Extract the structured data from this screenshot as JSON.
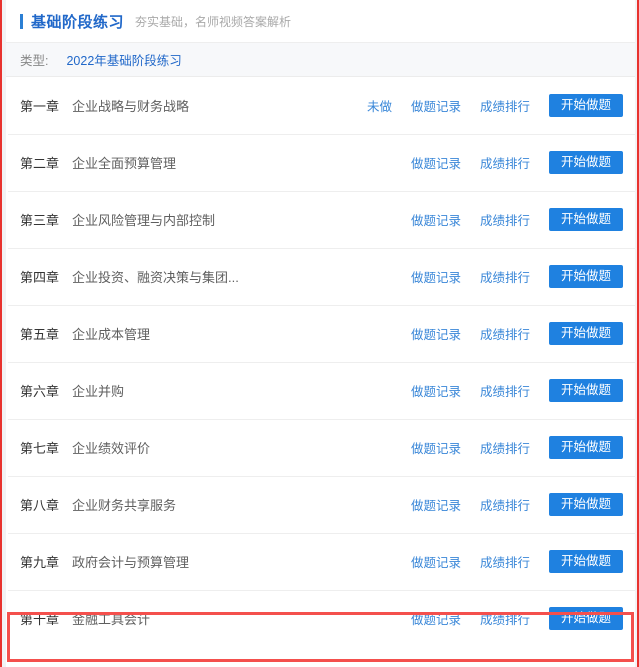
{
  "header": {
    "title": "基础阶段练习",
    "subtitle": "夯实基础，名师视频答案解析",
    "accent_color": "#2168c9"
  },
  "type_bar": {
    "label": "类型:",
    "selected_value": "2022年基础阶段练习"
  },
  "actions": {
    "record_label": "做题记录",
    "ranking_label": "成绩排行",
    "start_label": "开始做题",
    "button_color": "#1f81e0",
    "link_color": "#3a87d8"
  },
  "highlight": {
    "color": "#f4504d",
    "target_row_index": 9
  },
  "chapters": [
    {
      "number": "第一章",
      "title": "企业战略与财务战略",
      "status": "未做",
      "record_label": "做题记录",
      "ranking_label": "成绩排行",
      "start_label": "开始做题"
    },
    {
      "number": "第二章",
      "title": "企业全面预算管理",
      "status": "",
      "record_label": "做题记录",
      "ranking_label": "成绩排行",
      "start_label": "开始做题"
    },
    {
      "number": "第三章",
      "title": "企业风险管理与内部控制",
      "status": "",
      "record_label": "做题记录",
      "ranking_label": "成绩排行",
      "start_label": "开始做题"
    },
    {
      "number": "第四章",
      "title": "企业投资、融资决策与集团...",
      "status": "",
      "record_label": "做题记录",
      "ranking_label": "成绩排行",
      "start_label": "开始做题"
    },
    {
      "number": "第五章",
      "title": "企业成本管理",
      "status": "",
      "record_label": "做题记录",
      "ranking_label": "成绩排行",
      "start_label": "开始做题"
    },
    {
      "number": "第六章",
      "title": "企业并购",
      "status": "",
      "record_label": "做题记录",
      "ranking_label": "成绩排行",
      "start_label": "开始做题"
    },
    {
      "number": "第七章",
      "title": "企业绩效评价",
      "status": "",
      "record_label": "做题记录",
      "ranking_label": "成绩排行",
      "start_label": "开始做题"
    },
    {
      "number": "第八章",
      "title": "企业财务共享服务",
      "status": "",
      "record_label": "做题记录",
      "ranking_label": "成绩排行",
      "start_label": "开始做题"
    },
    {
      "number": "第九章",
      "title": "政府会计与预算管理",
      "status": "",
      "record_label": "做题记录",
      "ranking_label": "成绩排行",
      "start_label": "开始做题"
    },
    {
      "number": "第十章",
      "title": "金融工具会计",
      "status": "",
      "record_label": "做题记录",
      "ranking_label": "成绩排行",
      "start_label": "开始做题"
    }
  ]
}
